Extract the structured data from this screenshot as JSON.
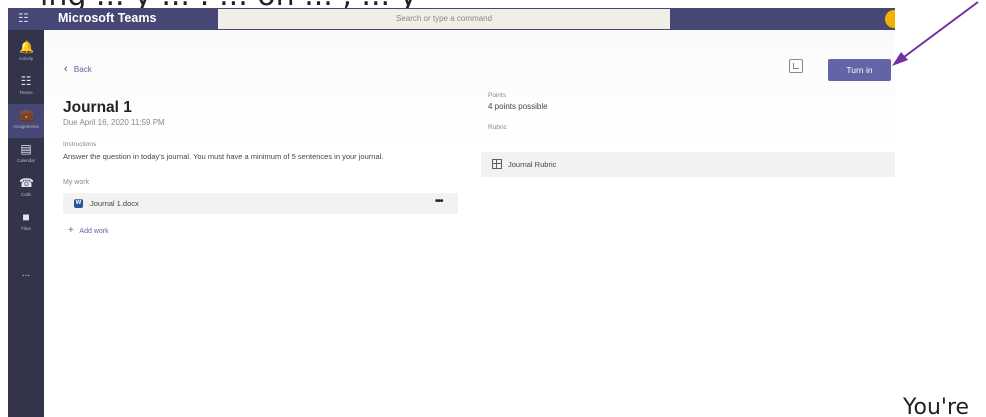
{
  "slide": {
    "caption_top": "ing ... y ... : ... on ... , ... y",
    "caption_bottom": "You're",
    "arrow_color": "#7030a0"
  },
  "titlebar": {
    "app_title": "Microsoft Teams",
    "search_placeholder": "Search or type a command",
    "accent": "#464775"
  },
  "rail": {
    "items": [
      {
        "icon": "bell-icon",
        "label": "Activity"
      },
      {
        "icon": "teams-icon",
        "label": "Teams"
      },
      {
        "icon": "assignments-icon",
        "label": "Assignments"
      },
      {
        "icon": "calendar-icon",
        "label": "Calendar"
      },
      {
        "icon": "phone-icon",
        "label": "Calls"
      },
      {
        "icon": "files-icon",
        "label": "Files"
      }
    ],
    "more": "..."
  },
  "assignment": {
    "back_label": "Back",
    "turn_in_label": "Turn in",
    "title": "Journal 1",
    "due": "Due April 16, 2020 11:59 PM",
    "instructions_label": "Instructions",
    "instructions_text": "Answer the question in today's journal. You must have a minimum of 5 sentences in your journal.",
    "my_work_label": "My work",
    "file_name": "Journal 1.docx",
    "file_more": "•••",
    "add_work_label": "Add work",
    "points_label": "Points",
    "points_value": "4 points possible",
    "rubric_label": "Rubric",
    "rubric_name": "Journal Rubric"
  }
}
